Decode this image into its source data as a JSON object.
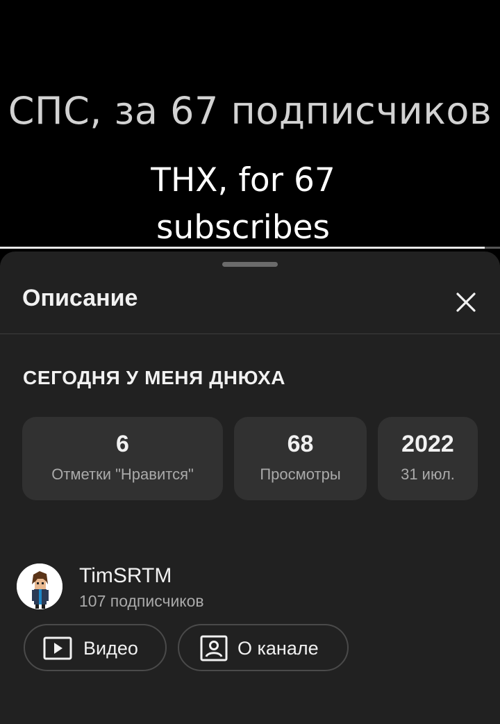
{
  "video": {
    "caption_ru": "СПС, за 67 подписчиков",
    "caption_en": "THX, for 67 subscribes",
    "progress": 0.97
  },
  "sheet": {
    "title": "Описание",
    "video_title": "СЕГОДНЯ У МЕНЯ ДНЮХА",
    "stats": {
      "likes": {
        "value": "6",
        "label": "Отметки \"Нравится\""
      },
      "views": {
        "value": "68",
        "label": "Просмотры"
      },
      "date": {
        "value": "2022",
        "label": "31 июл."
      }
    },
    "channel": {
      "name": "TimSRTM",
      "subscribers": "107 подписчиков"
    },
    "buttons": {
      "videos": "Видео",
      "about": "О канале"
    }
  },
  "icons": {
    "close": "close-icon",
    "videos": "play-box-icon",
    "about": "person-box-icon"
  }
}
